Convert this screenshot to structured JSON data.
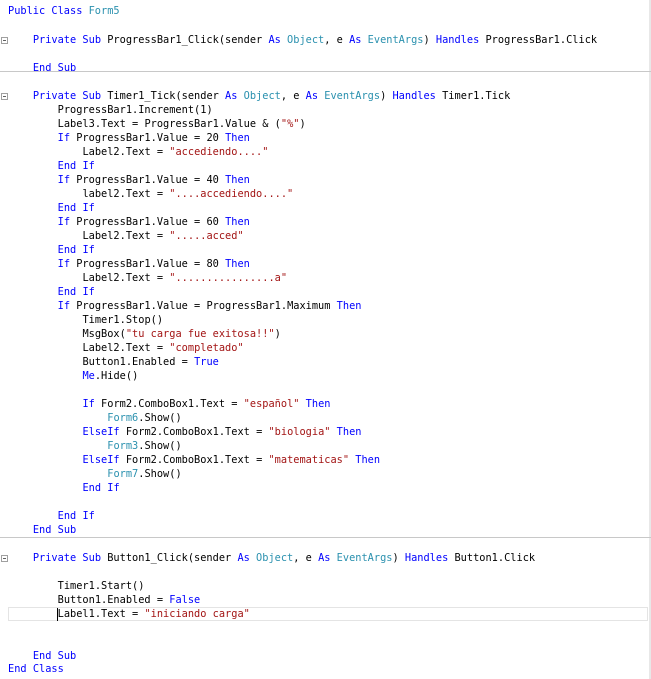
{
  "lines": [
    "Public Class Form5",
    "",
    "    Private Sub ProgressBar1_Click(sender As Object, e As EventArgs) Handles ProgressBar1.Click",
    "",
    "    End Sub",
    "",
    "    Private Sub Timer1_Tick(sender As Object, e As EventArgs) Handles Timer1.Tick",
    "        ProgressBar1.Increment(1)",
    "        Label3.Text = ProgressBar1.Value & (\"%\")",
    "        If ProgressBar1.Value = 20 Then",
    "            Label2.Text = \"accediendo....\"",
    "        End If",
    "        If ProgressBar1.Value = 40 Then",
    "            label2.Text = \"....accediendo....\"",
    "        End If",
    "        If ProgressBar1.Value = 60 Then",
    "            Label2.Text = \".....acced\"",
    "        End If",
    "        If ProgressBar1.Value = 80 Then",
    "            Label2.Text = \"................a\"",
    "        End If",
    "        If ProgressBar1.Value = ProgressBar1.Maximum Then",
    "            Timer1.Stop()",
    "            MsgBox(\"tu carga fue exitosa!!\")",
    "            Label2.Text = \"completado\"",
    "            Button1.Enabled = True",
    "            Me.Hide()",
    "",
    "            If Form2.ComboBox1.Text = \"español\" Then",
    "                Form6.Show()",
    "            ElseIf Form2.ComboBox1.Text = \"biologia\" Then",
    "                Form3.Show()",
    "            ElseIf Form2.ComboBox1.Text = \"matematicas\" Then",
    "                Form7.Show()",
    "            End If",
    "",
    "        End If",
    "    End Sub",
    "",
    "    Private Sub Button1_Click(sender As Object, e As EventArgs) Handles Button1.Click",
    "",
    "        Timer1.Start()",
    "        Button1.Enabled = False",
    "        Label1.Text = \"iniciando carga\"",
    "        ",
    "",
    "    End Sub",
    "End Class"
  ],
  "keywords": [
    "Public",
    "Class",
    "Private",
    "Sub",
    "As",
    "Handles",
    "End",
    "If",
    "Then",
    "ElseIf",
    "True",
    "False",
    "Me"
  ],
  "types": [
    "Form5",
    "Form6",
    "Form3",
    "Form7",
    "Object",
    "EventArgs"
  ],
  "colors": {
    "keyword": "#0000ff",
    "type": "#2b91af",
    "string": "#a31515",
    "separator": "#c8c8c8"
  }
}
